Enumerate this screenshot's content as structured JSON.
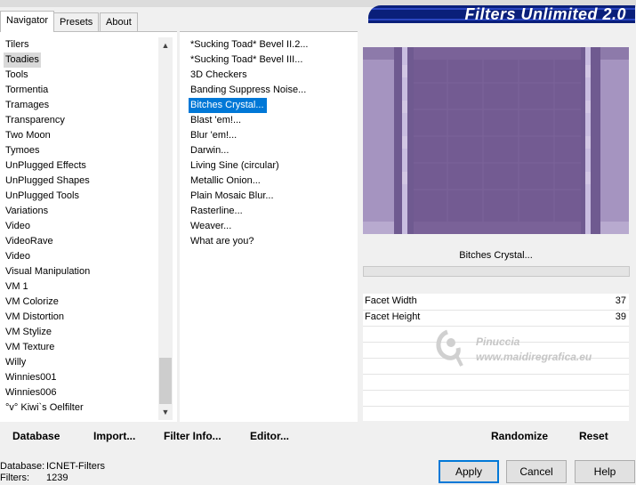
{
  "banner": {
    "title": "Filters Unlimited 2.0"
  },
  "tabs": [
    {
      "label": "Navigator"
    },
    {
      "label": "Presets"
    },
    {
      "label": "About"
    }
  ],
  "categories": [
    "Tilers",
    "Toadies",
    "Tools",
    "Tormentia",
    "Tramages",
    "Transparency",
    "Two Moon",
    "Tymoes",
    "UnPlugged Effects",
    "UnPlugged Shapes",
    "UnPlugged Tools",
    "Variations",
    "Video",
    "VideoRave",
    "Video",
    "Visual Manipulation",
    "VM 1",
    "VM Colorize",
    "VM Distortion",
    "VM Stylize",
    "VM Texture",
    "Willy",
    "Winnies001",
    "Winnies006",
    "°v° Kiwi`s Oelfilter"
  ],
  "selected_category_index": 1,
  "filters": [
    "*Sucking Toad*  Bevel II.2...",
    "*Sucking Toad*  Bevel III...",
    "3D Checkers",
    "Banding Suppress Noise...",
    "Bitches Crystal...",
    "Blast 'em!...",
    "Blur 'em!...",
    "Darwin...",
    "Living Sine (circular)",
    "Metallic Onion...",
    "Plain Mosaic Blur...",
    "Rasterline...",
    "Weaver...",
    "What are you?"
  ],
  "selected_filter_index": 4,
  "current_filter": "Bitches Crystal...",
  "params": [
    {
      "label": "Facet Width",
      "value": "37"
    },
    {
      "label": "Facet Height",
      "value": "39"
    }
  ],
  "buttons": {
    "database": "Database",
    "import": "Import...",
    "filter_info": "Filter Info...",
    "editor": "Editor...",
    "randomize": "Randomize",
    "reset": "Reset",
    "apply": "Apply",
    "cancel": "Cancel",
    "help": "Help"
  },
  "info": {
    "database_label": "Database:",
    "database_value": "ICNET-Filters",
    "filters_label": "Filters:",
    "filters_value": "1239"
  },
  "watermark": {
    "line1": "Pinuccia",
    "line2": "www.maidiregrafica.eu"
  },
  "colors": {
    "banner": "#0a1f7a",
    "selection": "#0078d7",
    "preview_purple": "#7a6298"
  }
}
